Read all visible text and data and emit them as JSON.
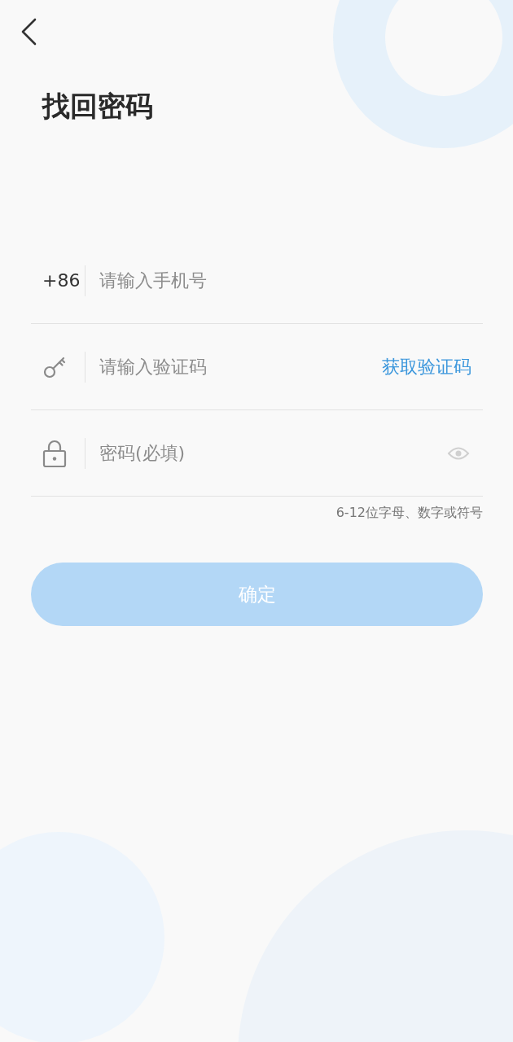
{
  "title": "找回密码",
  "fields": [
    {
      "kind": "phone",
      "prefix": "+86",
      "placeholder": "请输入手机号"
    },
    {
      "kind": "code",
      "placeholder": "请输入验证码",
      "action": "获取验证码"
    },
    {
      "kind": "password",
      "placeholder": "密码(必填)"
    }
  ],
  "hint": "6-12位字母、数字或符号",
  "submit": {
    "label": "确定",
    "disabled": true
  }
}
